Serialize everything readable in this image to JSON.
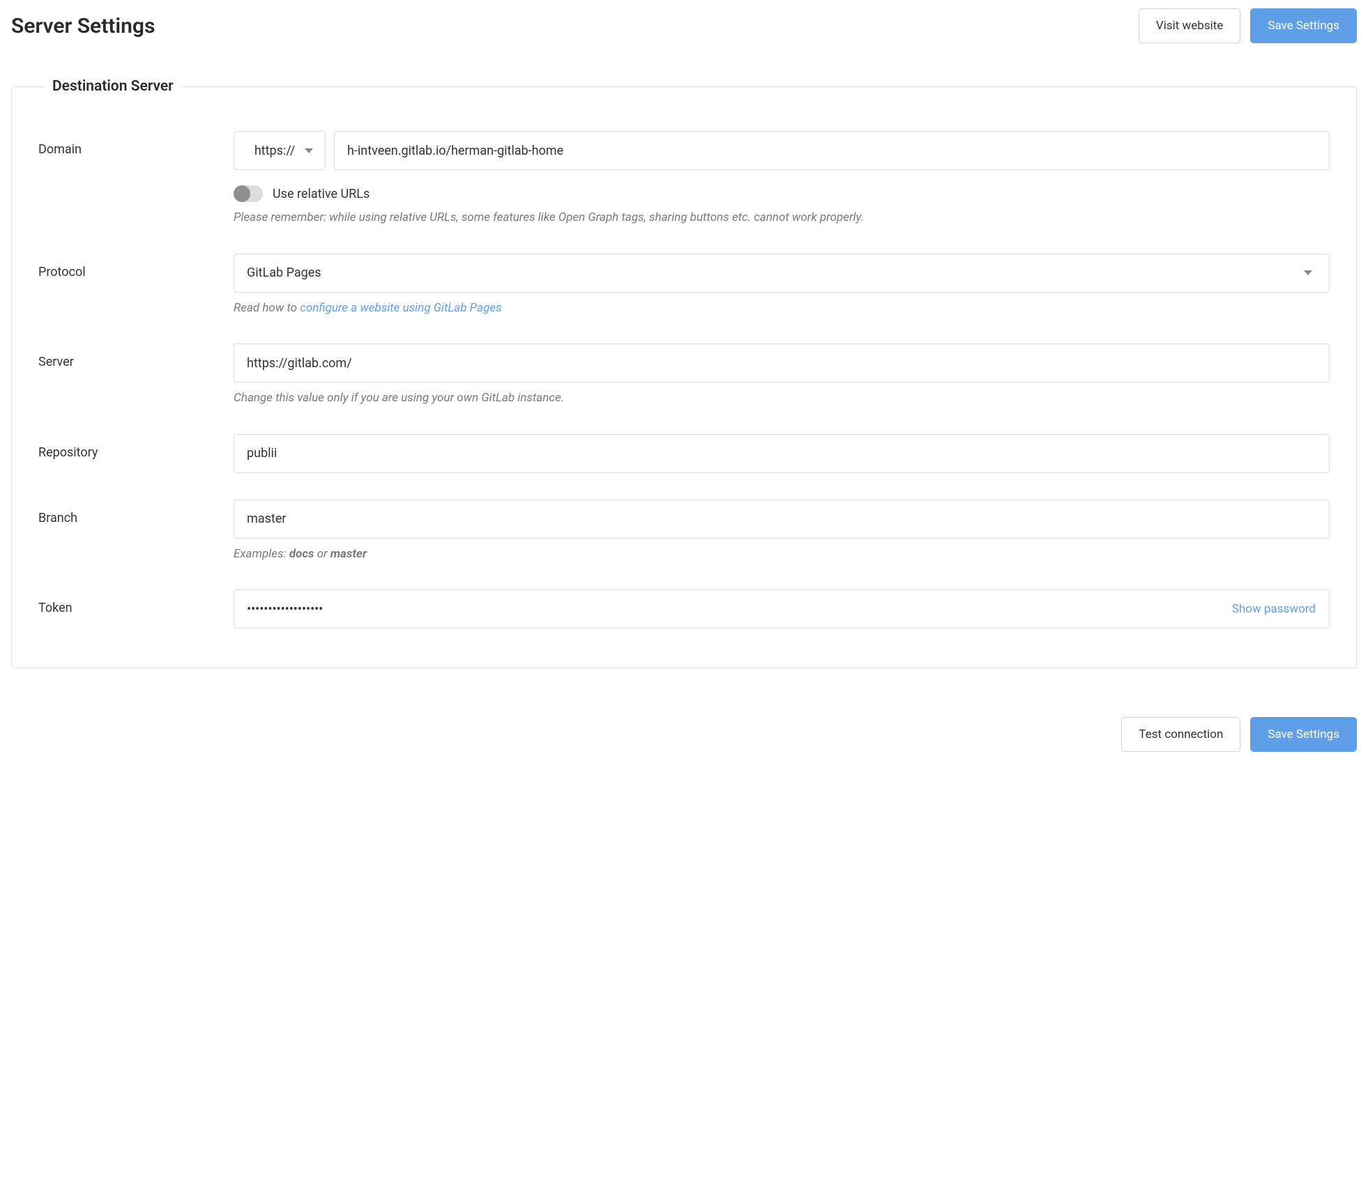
{
  "header": {
    "title": "Server Settings",
    "visit_website_label": "Visit website",
    "save_settings_label": "Save Settings"
  },
  "panel": {
    "title": "Destination Server"
  },
  "domain": {
    "label": "Domain",
    "scheme": "https://",
    "value": "h-intveen.gitlab.io/herman-gitlab-home",
    "relative_urls_label": "Use relative URLs",
    "relative_urls_hint": "Please remember: while using relative URLs, some features like Open Graph tags, sharing buttons etc. cannot work properly."
  },
  "protocol": {
    "label": "Protocol",
    "value": "GitLab Pages",
    "hint_prefix": "Read how to ",
    "hint_link": "configure a website using GitLab Pages"
  },
  "server": {
    "label": "Server",
    "value": "https://gitlab.com/",
    "hint": "Change this value only if you are using your own GitLab instance."
  },
  "repository": {
    "label": "Repository",
    "value": "publii"
  },
  "branch": {
    "label": "Branch",
    "value": "master",
    "hint_prefix": "Examples: ",
    "hint_ex1": "docs",
    "hint_or": " or ",
    "hint_ex2": "master"
  },
  "token": {
    "label": "Token",
    "value": "••••••••••••••••••",
    "show_password_label": "Show password"
  },
  "footer": {
    "test_connection_label": "Test connection",
    "save_settings_label": "Save Settings"
  }
}
